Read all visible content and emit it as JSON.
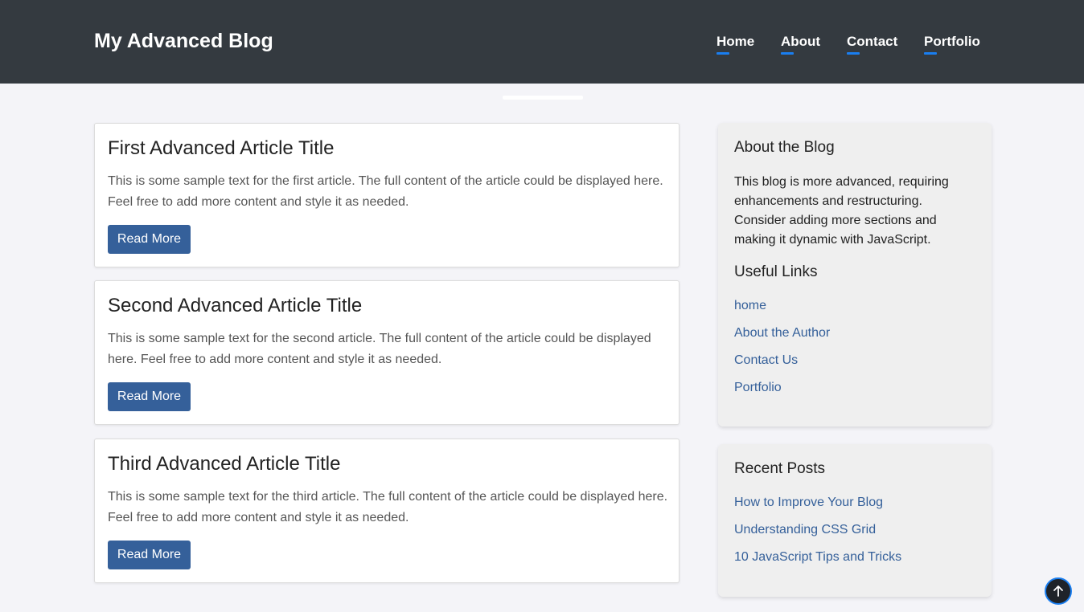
{
  "header": {
    "title": "My Advanced Blog",
    "nav": [
      {
        "label": "Home"
      },
      {
        "label": "About"
      },
      {
        "label": "Contact"
      },
      {
        "label": "Portfolio"
      }
    ]
  },
  "articles": [
    {
      "title": "First Advanced Article Title",
      "text": "This is some sample text for the first article. The full content of the article could be displayed here. Feel free to add more content and style it as needed.",
      "button": "Read More"
    },
    {
      "title": "Second Advanced Article Title",
      "text": "This is some sample text for the second article. The full content of the article could be displayed here. Feel free to add more content and style it as needed.",
      "button": "Read More"
    },
    {
      "title": "Third Advanced Article Title",
      "text": "This is some sample text for the third article. The full content of the article could be displayed here. Feel free to add more content and style it as needed.",
      "button": "Read More"
    }
  ],
  "sidebar": {
    "about": {
      "heading": "About the Blog",
      "text": "This blog is more advanced, requiring enhancements and restructuring. Consider adding more sections and making it dynamic with JavaScript."
    },
    "links": {
      "heading": "Useful Links",
      "items": [
        "home",
        "About the Author",
        "Contact Us",
        "Portfolio"
      ]
    },
    "recent": {
      "heading": "Recent Posts",
      "items": [
        "How to Improve Your Blog",
        "Understanding CSS Grid",
        "10 JavaScript Tips and Tricks"
      ]
    }
  },
  "back_to_top": {
    "icon": "arrow-up-icon"
  },
  "colors": {
    "header_bg": "#343a40",
    "accent": "#1a7ef0",
    "button_bg": "#35609a",
    "link": "#35609a",
    "page_bg": "#f4f4f8"
  }
}
